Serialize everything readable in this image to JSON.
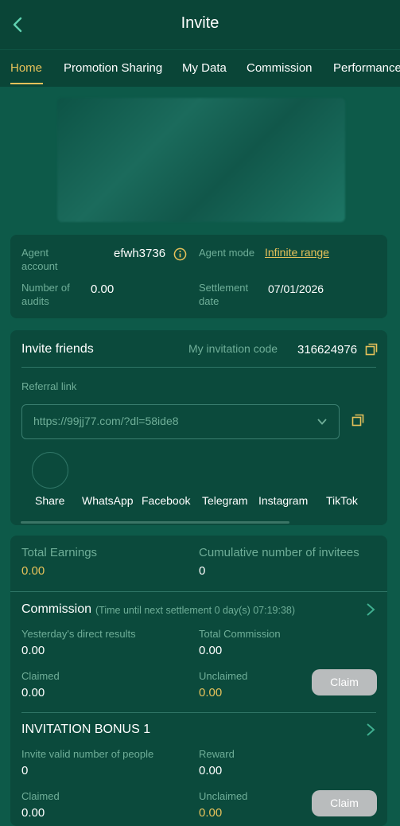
{
  "header": {
    "title": "Invite"
  },
  "tabs": [
    {
      "label": "Home"
    },
    {
      "label": "Promotion Sharing"
    },
    {
      "label": "My Data"
    },
    {
      "label": "Commission"
    },
    {
      "label": "Performance"
    }
  ],
  "agent": {
    "account_label": "Agent account",
    "account_value": "efwh3736",
    "mode_label": "Agent mode",
    "mode_value": "Infinite range",
    "audits_label": "Number of audits",
    "audits_value": "0.00",
    "settlement_label": "Settlement date",
    "settlement_value": "07/01/2026"
  },
  "invite": {
    "title": "Invite friends",
    "code_label": "My invitation code",
    "code_value": "316624976",
    "referral_label": "Referral link",
    "referral_value": "https://99jj77.com/?dl=58ide8",
    "share_options": [
      "Share",
      "WhatsApp",
      "Facebook",
      "Telegram",
      "Instagram",
      "TikTok"
    ]
  },
  "earnings": {
    "total_label": "Total Earnings",
    "total_value": "0.00",
    "invitees_label": "Cumulative number of invitees",
    "invitees_value": "0"
  },
  "commission": {
    "title": "Commission",
    "subtitle": "(Time until next settlement 0 day(s) 07:19:38)",
    "yesterday_label": "Yesterday's direct results",
    "yesterday_value": "0.00",
    "total_label": "Total Commission",
    "total_value": "0.00",
    "claimed_label": "Claimed",
    "claimed_value": "0.00",
    "unclaimed_label": "Unclaimed",
    "unclaimed_value": "0.00",
    "claim_button": "Claim"
  },
  "bonus": {
    "title": "INVITATION BONUS 1",
    "valid_label": "Invite valid number of people",
    "valid_value": "0",
    "reward_label": "Reward",
    "reward_value": "0.00",
    "claimed_label": "Claimed",
    "claimed_value": "0.00",
    "unclaimed_label": "Unclaimed",
    "unclaimed_value": "0.00",
    "claim_button": "Claim"
  },
  "colors": {
    "accent": "#e6c15a",
    "background": "#0d5a49",
    "card": "#0b4a3c"
  }
}
